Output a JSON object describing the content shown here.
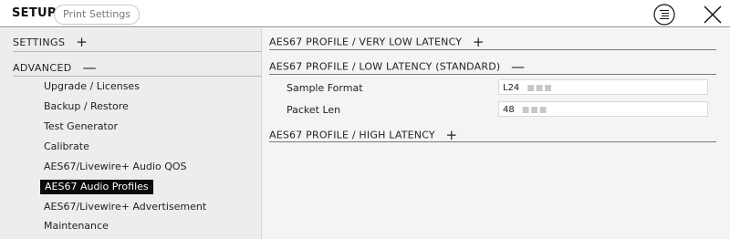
{
  "header": {
    "title": "SETUP",
    "print_settings_label": "Print Settings",
    "menu_icon": "list-menu-icon",
    "close_icon": "close-icon"
  },
  "sidebar": {
    "settings": {
      "label": "SETTINGS",
      "symbol": "+"
    },
    "advanced": {
      "label": "ADVANCED",
      "symbol": "—"
    },
    "items": [
      {
        "label": "Upgrade / Licenses"
      },
      {
        "label": "Backup / Restore"
      },
      {
        "label": "Test Generator"
      },
      {
        "label": "Calibrate"
      },
      {
        "label": "AES67/Livewire+ Audio QOS"
      },
      {
        "label": "AES67 Audio Profiles",
        "active": true
      },
      {
        "label": "AES67/Livewire+ Advertisement"
      },
      {
        "label": "Maintenance"
      }
    ]
  },
  "content": {
    "very_low": {
      "label": "AES67 PROFILE / VERY LOW LATENCY",
      "symbol": "+"
    },
    "low": {
      "label": "AES67 PROFILE / LOW LATENCY (STANDARD)",
      "symbol": "—",
      "fields": [
        {
          "label": "Sample Format",
          "value": "L24"
        },
        {
          "label": "Packet Len",
          "value": "48"
        }
      ]
    },
    "high": {
      "label": "AES67 PROFILE / HIGH LATENCY",
      "symbol": "+"
    }
  },
  "colors": {
    "active_bg": "#0a0a0a",
    "sidebar_bg": "#ededed",
    "content_bg": "#f4f4f4"
  }
}
